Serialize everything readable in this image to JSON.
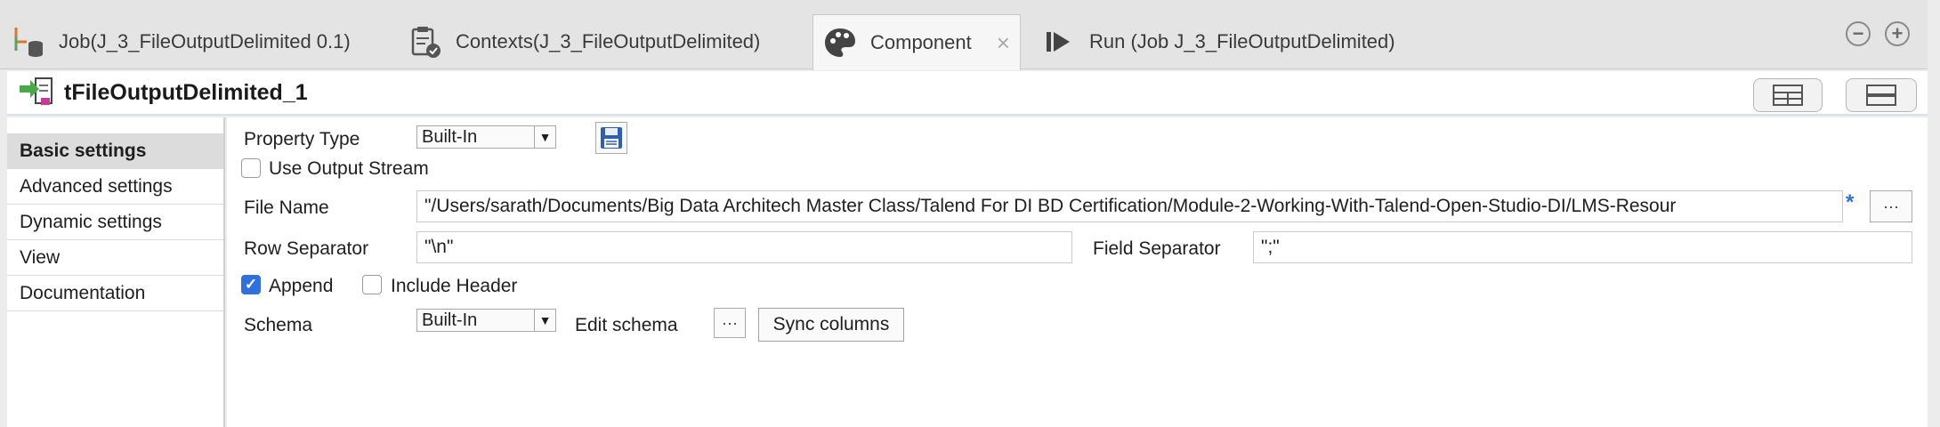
{
  "tabs": [
    {
      "label": "Job(J_3_FileOutputDelimited 0.1)",
      "icon": "job-icon",
      "active": false
    },
    {
      "label": "Contexts(J_3_FileOutputDelimited)",
      "icon": "contexts-clipboard-icon",
      "active": false
    },
    {
      "label": "Component",
      "icon": "palette-icon",
      "active": true,
      "close": "×"
    },
    {
      "label": "Run (Job J_3_FileOutputDelimited)",
      "icon": "run-icon",
      "active": false
    }
  ],
  "window_controls": {
    "minimize": "−",
    "maximize": "+"
  },
  "component": {
    "title": "tFileOutputDelimited_1"
  },
  "nav": [
    "Basic settings",
    "Advanced settings",
    "Dynamic settings",
    "View",
    "Documentation"
  ],
  "settings": {
    "property_type_label": "Property Type",
    "property_type_value": "Built-In",
    "use_output_stream_label": "Use Output Stream",
    "file_name_label": "File Name",
    "file_name_value": "\"/Users/sarath/Documents/Big Data Architech Master Class/Talend For DI BD Certification/Module-2-Working-With-Talend-Open-Studio-DI/LMS-Resour",
    "required_marker": "*",
    "row_separator_label": "Row Separator",
    "row_separator_value": "\"\\n\"",
    "field_separator_label": "Field Separator",
    "field_separator_value": "\";\"",
    "append_label": "Append",
    "include_header_label": "Include Header",
    "schema_label": "Schema",
    "schema_value": "Built-In",
    "edit_schema_label": "Edit schema",
    "ellipsis": "···",
    "sync_columns_label": "Sync columns"
  },
  "colors": {
    "accent": "#2f6fde",
    "tab_bg": "#e4e4e4",
    "active_nav": "#dcdcdc"
  }
}
